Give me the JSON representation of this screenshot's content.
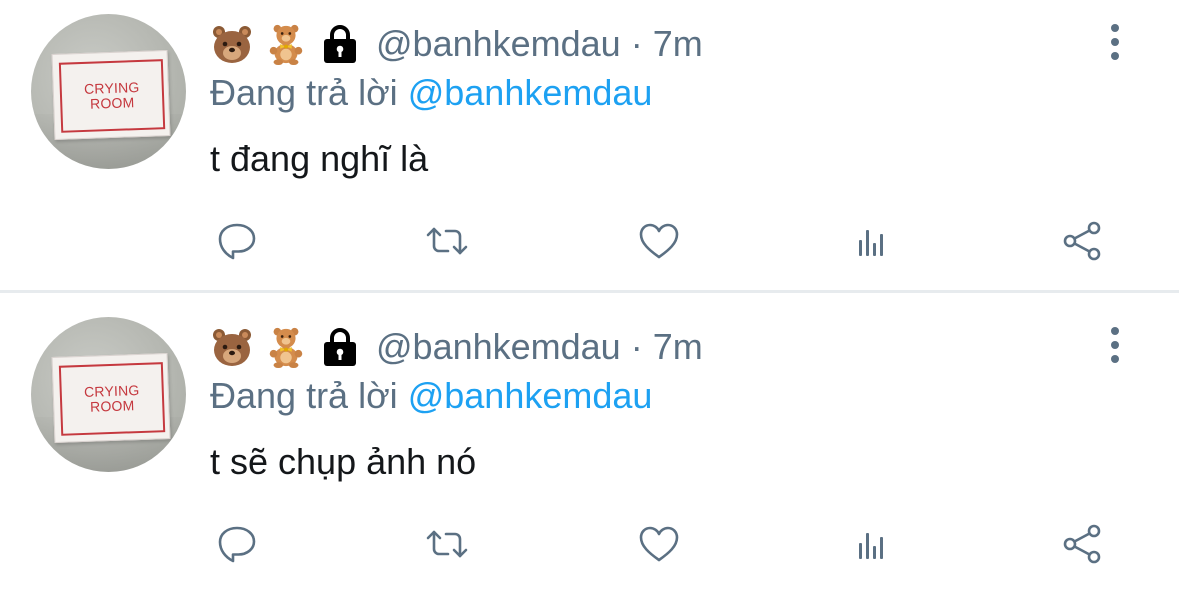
{
  "colors": {
    "secondary_text": "#5b7083",
    "mention": "#1da1f2",
    "primary_text": "#14171a",
    "divider": "#e7ebee",
    "sign_red": "#c5393f"
  },
  "tweets": [
    {
      "avatar": {
        "sign_line1": "CRYING",
        "sign_line2": "ROOM"
      },
      "badges": [
        "bear-face-icon",
        "teddy-bear-icon",
        "lock-icon"
      ],
      "handle": "@banhkemdau",
      "separator": "·",
      "time": "7m",
      "reply_prefix": "Đang trả lời",
      "reply_to": "@banhkemdau",
      "text": "t đang nghĩ là",
      "actions": [
        "reply-icon",
        "retweet-icon",
        "like-icon",
        "analytics-icon",
        "share-icon"
      ]
    },
    {
      "avatar": {
        "sign_line1": "CRYING",
        "sign_line2": "ROOM"
      },
      "badges": [
        "bear-face-icon",
        "teddy-bear-icon",
        "lock-icon"
      ],
      "handle": "@banhkemdau",
      "separator": "·",
      "time": "7m",
      "reply_prefix": "Đang trả lời",
      "reply_to": "@banhkemdau",
      "text": "t sẽ chụp ảnh nó",
      "actions": [
        "reply-icon",
        "retweet-icon",
        "like-icon",
        "analytics-icon",
        "share-icon"
      ]
    }
  ]
}
